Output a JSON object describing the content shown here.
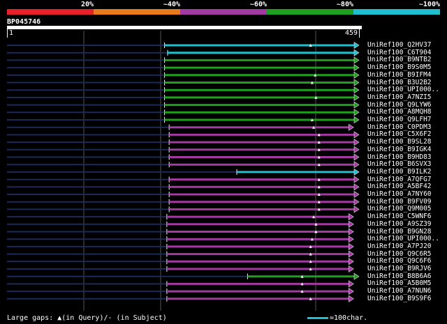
{
  "scale": {
    "labels": [
      "20%",
      "~40%",
      "~60%",
      "~80%",
      "~100%"
    ],
    "colors": [
      "#e8202a",
      "#e87a1e",
      "#a23aa2",
      "#1ea01e",
      "#1fbfcf"
    ]
  },
  "query": {
    "id": "BP045746",
    "start": "1",
    "end": "459",
    "length": 459
  },
  "hits": [
    {
      "label": "UniRef100_Q2HV37",
      "start": 206,
      "end": 459,
      "color": "#1fbfcf",
      "tri": 396
    },
    {
      "label": "UniRef100_C6T904",
      "start": 210,
      "end": 459,
      "color": "#1fbfcf",
      "tri": null
    },
    {
      "label": "UniRef100_B9NTB2",
      "start": 206,
      "end": 459,
      "color": "#1ea01e",
      "tri": null
    },
    {
      "label": "UniRef100_B9S0M5",
      "start": 206,
      "end": 459,
      "color": "#1ea01e",
      "tri": null
    },
    {
      "label": "UniRef100_B9IFM4",
      "start": 206,
      "end": 459,
      "color": "#1ea01e",
      "tri": 402
    },
    {
      "label": "UniRef100_B3U2B2",
      "start": 206,
      "end": 459,
      "color": "#1ea01e",
      "tri": 398
    },
    {
      "label": "UniRef100_UPI000..",
      "start": 206,
      "end": 459,
      "color": "#1ea01e",
      "tri": null
    },
    {
      "label": "UniRef100_A7NZI5",
      "start": 206,
      "end": 459,
      "color": "#1ea01e",
      "tri": 403
    },
    {
      "label": "UniRef100_Q9LYW6",
      "start": 206,
      "end": 459,
      "color": "#1ea01e",
      "tri": null
    },
    {
      "label": "UniRef100_A8MQH8",
      "start": 206,
      "end": 459,
      "color": "#1ea01e",
      "tri": null
    },
    {
      "label": "UniRef100_Q9LFH7",
      "start": 206,
      "end": 459,
      "color": "#1ea01e",
      "tri": 398
    },
    {
      "label": "UniRef100_C0PDM3",
      "start": 212,
      "end": 452,
      "color": "#a23aa2",
      "tri": 400
    },
    {
      "label": "UniRef100_C5X6F2",
      "start": 212,
      "end": 459,
      "color": "#a23aa2",
      "tri": 407
    },
    {
      "label": "UniRef100_B9SL28",
      "start": 212,
      "end": 459,
      "color": "#a23aa2",
      "tri": 407
    },
    {
      "label": "UniRef100_B9IGK4",
      "start": 212,
      "end": 459,
      "color": "#a23aa2",
      "tri": 407
    },
    {
      "label": "UniRef100_B9HD83",
      "start": 212,
      "end": 459,
      "color": "#a23aa2",
      "tri": 407
    },
    {
      "label": "UniRef100_B6SVX3",
      "start": 212,
      "end": 459,
      "color": "#a23aa2",
      "tri": 407
    },
    {
      "label": "UniRef100_B9ILK2",
      "start": 300,
      "end": 459,
      "color": "#1fbfcf",
      "tri": null
    },
    {
      "label": "UniRef100_A7QFG7",
      "start": 212,
      "end": 459,
      "color": "#a23aa2",
      "tri": 407
    },
    {
      "label": "UniRef100_A5BF42",
      "start": 212,
      "end": 459,
      "color": "#a23aa2",
      "tri": 407
    },
    {
      "label": "UniRef100_A7NY60",
      "start": 212,
      "end": 459,
      "color": "#a23aa2",
      "tri": 407
    },
    {
      "label": "UniRef100_B9FV09",
      "start": 212,
      "end": 459,
      "color": "#a23aa2",
      "tri": 407
    },
    {
      "label": "UniRef100_Q9M005",
      "start": 212,
      "end": 459,
      "color": "#a23aa2",
      "tri": 407
    },
    {
      "label": "UniRef100_C5WNF6",
      "start": 209,
      "end": 452,
      "color": "#a23aa2",
      "tri": 400
    },
    {
      "label": "UniRef100_A9SZ39",
      "start": 209,
      "end": 452,
      "color": "#a23aa2",
      "tri": 403
    },
    {
      "label": "UniRef100_B9GN28",
      "start": 209,
      "end": 452,
      "color": "#a23aa2",
      "tri": 403
    },
    {
      "label": "UniRef100_UPI000..",
      "start": 209,
      "end": 452,
      "color": "#a23aa2",
      "tri": 398
    },
    {
      "label": "UniRef100_A7PJ20",
      "start": 209,
      "end": 452,
      "color": "#a23aa2",
      "tri": 396
    },
    {
      "label": "UniRef100_Q9C6R5",
      "start": 209,
      "end": 452,
      "color": "#a23aa2",
      "tri": 396
    },
    {
      "label": "UniRef100_Q9C6F6",
      "start": 209,
      "end": 452,
      "color": "#a23aa2",
      "tri": 396
    },
    {
      "label": "UniRef100_B9RJV6",
      "start": 209,
      "end": 452,
      "color": "#a23aa2",
      "tri": 396
    },
    {
      "label": "UniRef100_B8B6A6",
      "start": 314,
      "end": 459,
      "color": "#1ea01e",
      "tri": 385
    },
    {
      "label": "UniRef100_A5B0M5",
      "start": 209,
      "end": 452,
      "color": "#a23aa2",
      "tri": 385
    },
    {
      "label": "UniRef100_A7NUN6",
      "start": 209,
      "end": 452,
      "color": "#a23aa2",
      "tri": 385
    },
    {
      "label": "UniRef100_B9S9F6",
      "start": 209,
      "end": 452,
      "color": "#a23aa2",
      "tri": 396
    }
  ],
  "footer": {
    "legend": "Large gaps: ▲(in Query)/- (in Subject)",
    "scale_text": "=100char."
  },
  "colors": {
    "background": "#000000",
    "guide": "#555555",
    "left_tail": "#1c2a5a",
    "gap_triangle": "#ffffff"
  }
}
